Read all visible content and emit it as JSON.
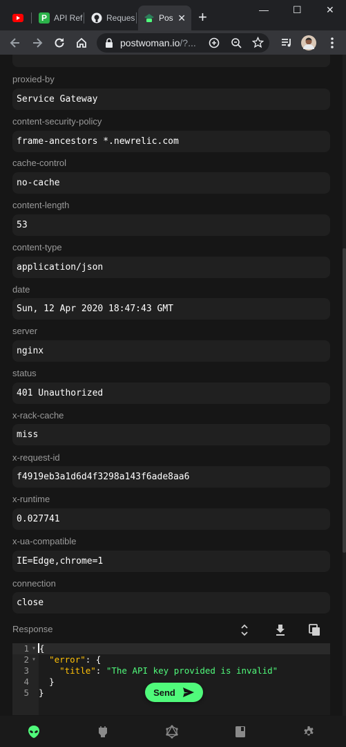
{
  "browser": {
    "tabs": [
      {
        "label": "",
        "icon": "youtube-icon"
      },
      {
        "label": "API Ref",
        "icon": "postman-api-icon"
      },
      {
        "label": "Reques",
        "icon": "github-icon"
      },
      {
        "label": "Pos",
        "icon": "postwoman-icon"
      }
    ],
    "new_tab": "+",
    "window_controls": {
      "minimize": "—",
      "maximize": "☐",
      "close": "✕"
    },
    "url": {
      "host": "postwoman.io",
      "rest": "/?..."
    }
  },
  "partial_value": "401",
  "headers": [
    {
      "key": "proxied-by",
      "value": "Service Gateway"
    },
    {
      "key": "content-security-policy",
      "value": "frame-ancestors *.newrelic.com"
    },
    {
      "key": "cache-control",
      "value": "no-cache"
    },
    {
      "key": "content-length",
      "value": "53"
    },
    {
      "key": "content-type",
      "value": "application/json"
    },
    {
      "key": "date",
      "value": "Sun, 12 Apr 2020 18:47:43 GMT"
    },
    {
      "key": "server",
      "value": "nginx"
    },
    {
      "key": "status",
      "value": "401 Unauthorized"
    },
    {
      "key": "x-rack-cache",
      "value": "miss"
    },
    {
      "key": "x-request-id",
      "value": "f4919eb3a1d6d4f3298a143f6ade8aa6"
    },
    {
      "key": "x-runtime",
      "value": "0.027741"
    },
    {
      "key": "x-ua-compatible",
      "value": "IE=Edge,chrome=1"
    },
    {
      "key": "connection",
      "value": "close"
    }
  ],
  "response": {
    "label": "Response",
    "line_numbers": [
      "1",
      "2",
      "3",
      "4",
      "5"
    ],
    "code": {
      "open": "{",
      "error_key": "\"error\"",
      "colon_open": ": {",
      "title_key": "\"title\"",
      "colon": ": ",
      "title_value": "\"The API key provided is invalid\"",
      "close_inner": "}",
      "close": "}"
    }
  },
  "send_button": {
    "label": "Send"
  },
  "colors": {
    "accent": "#50fa7b",
    "key": "#ffc107",
    "background": "#161616"
  }
}
